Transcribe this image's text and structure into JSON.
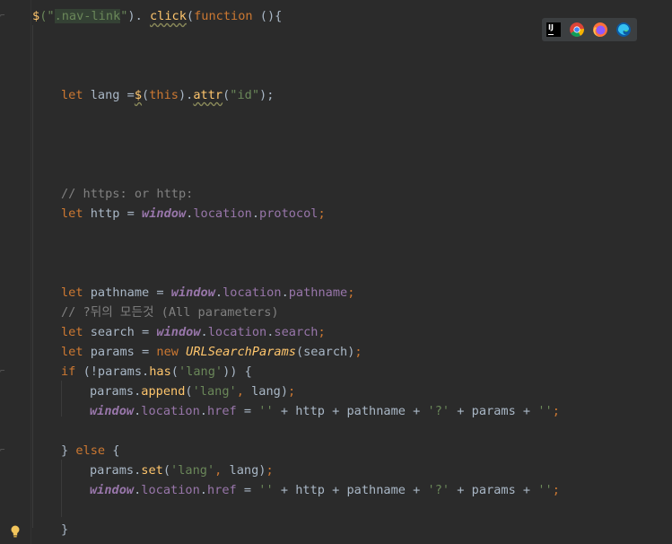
{
  "editor": {
    "lines": [
      {
        "id": "l1",
        "tokens": [
          [
            "fn",
            "$"
          ],
          [
            "str",
            "(\""
          ],
          [
            "sel-hl str",
            ".nav-link"
          ],
          [
            "str",
            "\""
          ],
          [
            "",
            "). "
          ],
          [
            "fn squig",
            "click"
          ],
          [
            "",
            "("
          ],
          [
            "kw",
            "function"
          ],
          [
            "",
            " (){"
          ]
        ]
      },
      {
        "id": "l2",
        "tokens": [
          [
            "kw",
            "let "
          ],
          [
            "",
            "lang ="
          ],
          [
            "fn squig",
            "$"
          ],
          [
            "",
            "("
          ],
          [
            "kw",
            "this"
          ],
          [
            "",
            ")."
          ],
          [
            "fn squig",
            "attr"
          ],
          [
            "",
            "("
          ],
          [
            "str",
            "\"id\""
          ],
          [
            "",
            ");"
          ]
        ]
      },
      {
        "id": "l3",
        "tokens": [
          [
            "cm",
            "// https: or http:"
          ]
        ]
      },
      {
        "id": "l4",
        "tokens": [
          [
            "kw",
            "let "
          ],
          [
            "",
            "http = "
          ],
          [
            "gv",
            "window"
          ],
          [
            "",
            "."
          ],
          [
            "prop",
            "location"
          ],
          [
            "",
            "."
          ],
          [
            "prop",
            "protocol"
          ],
          [
            "kw",
            ";"
          ]
        ]
      },
      {
        "id": "l5",
        "tokens": [
          [
            "kw",
            "let "
          ],
          [
            "",
            "pathname = "
          ],
          [
            "gv",
            "window"
          ],
          [
            "",
            "."
          ],
          [
            "prop",
            "location"
          ],
          [
            "",
            "."
          ],
          [
            "prop",
            "pathname"
          ],
          [
            "kw",
            ";"
          ]
        ]
      },
      {
        "id": "l6",
        "tokens": [
          [
            "cm",
            "// ?뒤의 모든것 (All parameters)"
          ]
        ]
      },
      {
        "id": "l7",
        "tokens": [
          [
            "kw",
            "let "
          ],
          [
            "",
            "search = "
          ],
          [
            "gv",
            "window"
          ],
          [
            "",
            "."
          ],
          [
            "prop",
            "location"
          ],
          [
            "",
            "."
          ],
          [
            "prop",
            "search"
          ],
          [
            "kw",
            ";"
          ]
        ]
      },
      {
        "id": "l8",
        "tokens": [
          [
            "kw",
            "let "
          ],
          [
            "",
            "params = "
          ],
          [
            "kw",
            "new "
          ],
          [
            "cls",
            "URLSearchParams"
          ],
          [
            "",
            "(search)"
          ],
          [
            "kw",
            ";"
          ]
        ]
      },
      {
        "id": "l9",
        "tokens": [
          [
            "kw",
            "if "
          ],
          [
            "",
            "(!params."
          ],
          [
            "fn",
            "has"
          ],
          [
            "",
            "("
          ],
          [
            "str",
            "'lang'"
          ],
          [
            "",
            ")) {"
          ]
        ]
      },
      {
        "id": "l10",
        "tokens": [
          [
            "",
            "params."
          ],
          [
            "fn",
            "append"
          ],
          [
            "",
            "("
          ],
          [
            "str",
            "'lang'"
          ],
          [
            "kw",
            ", "
          ],
          [
            "",
            "lang)"
          ],
          [
            "kw",
            ";"
          ]
        ]
      },
      {
        "id": "l11",
        "tokens": [
          [
            "gv",
            "window"
          ],
          [
            "",
            "."
          ],
          [
            "prop",
            "location"
          ],
          [
            "",
            "."
          ],
          [
            "prop",
            "href"
          ],
          [
            "",
            " = "
          ],
          [
            "str",
            "''"
          ],
          [
            "",
            " + http + pathname + "
          ],
          [
            "str",
            "'?'"
          ],
          [
            "",
            " + params + "
          ],
          [
            "str",
            "''"
          ],
          [
            "kw",
            ";"
          ]
        ]
      },
      {
        "id": "l12",
        "tokens": [
          [
            "",
            "} "
          ],
          [
            "kw",
            "else "
          ],
          [
            "",
            "{"
          ]
        ]
      },
      {
        "id": "l13",
        "tokens": [
          [
            "",
            "params."
          ],
          [
            "fn",
            "set"
          ],
          [
            "",
            "("
          ],
          [
            "str",
            "'lang'"
          ],
          [
            "kw",
            ", "
          ],
          [
            "",
            "lang)"
          ],
          [
            "kw",
            ";"
          ]
        ]
      },
      {
        "id": "l14",
        "tokens": [
          [
            "gv",
            "window"
          ],
          [
            "",
            "."
          ],
          [
            "prop",
            "location"
          ],
          [
            "",
            "."
          ],
          [
            "prop",
            "href"
          ],
          [
            "",
            " = "
          ],
          [
            "str",
            "''"
          ],
          [
            "",
            " + http + pathname + "
          ],
          [
            "str",
            "'?'"
          ],
          [
            "",
            " + params + "
          ],
          [
            "str",
            "''"
          ],
          [
            "kw",
            ";"
          ]
        ]
      },
      {
        "id": "l15",
        "tokens": [
          [
            "",
            "}"
          ]
        ]
      }
    ]
  },
  "browser_bar": {
    "ij_label": "IJ",
    "icons": [
      "intellij-icon",
      "chrome-icon",
      "firefox-icon",
      "edge-icon"
    ]
  },
  "colors": {
    "background": "#2b2b2b",
    "keyword": "#cc7832",
    "string": "#6a8759",
    "comment": "#808080",
    "global": "#9876aa",
    "function": "#ffc66d",
    "text": "#a9b7c6"
  }
}
